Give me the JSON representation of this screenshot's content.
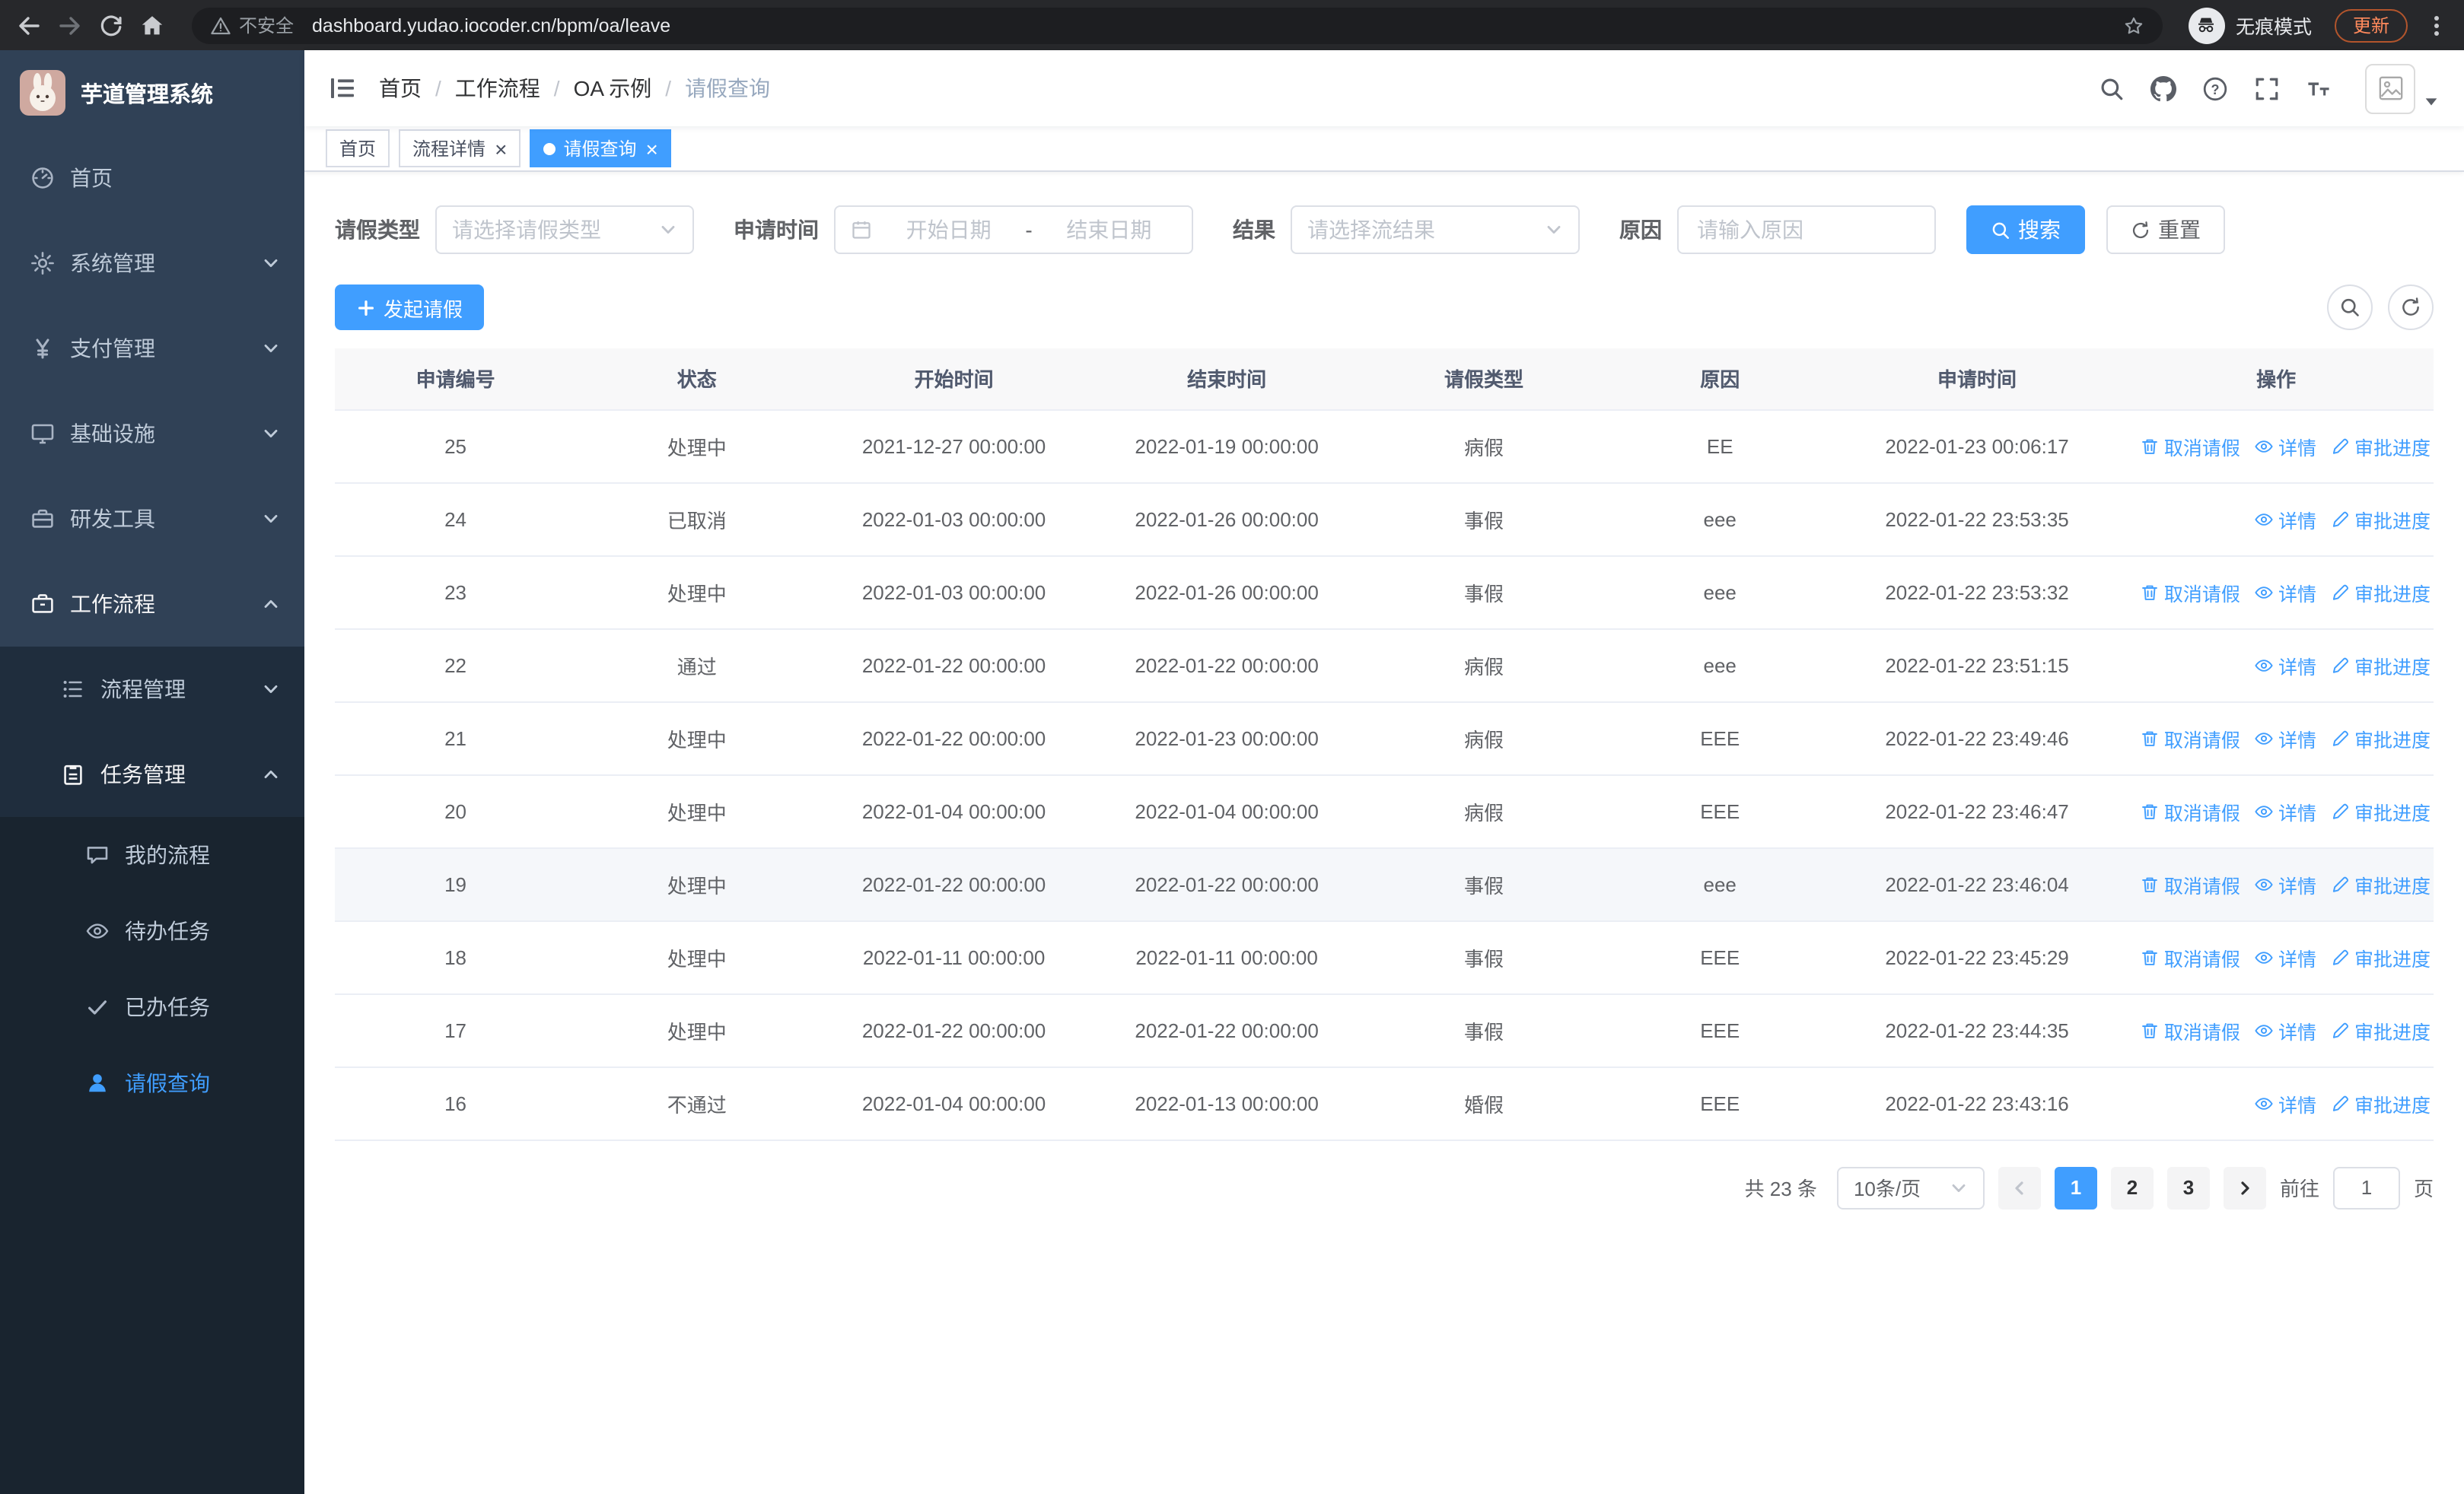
{
  "colors": {
    "primary": "#409eff",
    "sidebar_bg": "#304156",
    "submenu_bg": "#1f2d3d",
    "active_tab_bg": "#409eff"
  },
  "browser": {
    "security_label": "不安全",
    "url": "dashboard.yudao.iocoder.cn/bpm/oa/leave",
    "incognito_label": "无痕模式",
    "update_label": "更新"
  },
  "sidebar": {
    "logo_title": "芋道管理系统",
    "menu": [
      {
        "label": "首页",
        "icon": "dashboard-icon",
        "level": 1
      },
      {
        "label": "系统管理",
        "icon": "gear-icon",
        "level": 1,
        "arrow": "down"
      },
      {
        "label": "支付管理",
        "icon": "yen-icon",
        "level": 1,
        "arrow": "down"
      },
      {
        "label": "基础设施",
        "icon": "monitor-icon",
        "level": 1,
        "arrow": "down"
      },
      {
        "label": "研发工具",
        "icon": "toolbox-icon",
        "level": 1,
        "arrow": "down"
      },
      {
        "label": "工作流程",
        "icon": "briefcase-icon",
        "level": 1,
        "arrow": "up",
        "open": true
      },
      {
        "label": "流程管理",
        "icon": "process-icon",
        "level": 2,
        "arrow": "down"
      },
      {
        "label": "任务管理",
        "icon": "task-icon",
        "level": 2,
        "arrow": "up",
        "open": true
      },
      {
        "label": "我的流程",
        "icon": "chat-icon",
        "level": 3
      },
      {
        "label": "待办任务",
        "icon": "eye-icon",
        "level": 3
      },
      {
        "label": "已办任务",
        "icon": "check-icon",
        "level": 3
      },
      {
        "label": "请假查询",
        "icon": "user-icon",
        "level": 3,
        "active": true
      }
    ]
  },
  "header": {
    "breadcrumb": [
      "首页",
      "工作流程",
      "OA 示例",
      "请假查询"
    ],
    "tools": [
      "search-icon",
      "github-icon",
      "help-icon",
      "fullscreen-icon",
      "font-size-icon"
    ]
  },
  "tabs": [
    {
      "label": "首页",
      "closable": false,
      "active": false
    },
    {
      "label": "流程详情",
      "closable": true,
      "active": false
    },
    {
      "label": "请假查询",
      "closable": true,
      "active": true
    }
  ],
  "filters": {
    "leave_type_label": "请假类型",
    "leave_type_placeholder": "请选择请假类型",
    "apply_time_label": "申请时间",
    "start_date_placeholder": "开始日期",
    "range_separator": "-",
    "end_date_placeholder": "结束日期",
    "result_label": "结果",
    "result_placeholder": "请选择流结果",
    "reason_label": "原因",
    "reason_placeholder": "请输入原因",
    "search_button": "搜索",
    "reset_button": "重置"
  },
  "toolbar": {
    "create_button": "发起请假"
  },
  "table": {
    "columns": [
      "申请编号",
      "状态",
      "开始时间",
      "结束时间",
      "请假类型",
      "原因",
      "申请时间",
      "操作"
    ],
    "actions_def": {
      "cancel": {
        "label": "取消请假",
        "icon": "trash-icon"
      },
      "detail": {
        "label": "详情",
        "icon": "eye-icon"
      },
      "progress": {
        "label": "审批进度",
        "icon": "edit-icon"
      }
    },
    "rows": [
      {
        "id": "25",
        "status": "处理中",
        "start": "2021-12-27 00:00:00",
        "end": "2022-01-19 00:00:00",
        "type": "病假",
        "reason": "EE",
        "applied": "2022-01-23 00:06:17",
        "actions": [
          "cancel",
          "detail",
          "progress"
        ]
      },
      {
        "id": "24",
        "status": "已取消",
        "start": "2022-01-03 00:00:00",
        "end": "2022-01-26 00:00:00",
        "type": "事假",
        "reason": "eee",
        "applied": "2022-01-22 23:53:35",
        "actions": [
          "detail",
          "progress"
        ]
      },
      {
        "id": "23",
        "status": "处理中",
        "start": "2022-01-03 00:00:00",
        "end": "2022-01-26 00:00:00",
        "type": "事假",
        "reason": "eee",
        "applied": "2022-01-22 23:53:32",
        "actions": [
          "cancel",
          "detail",
          "progress"
        ]
      },
      {
        "id": "22",
        "status": "通过",
        "start": "2022-01-22 00:00:00",
        "end": "2022-01-22 00:00:00",
        "type": "病假",
        "reason": "eee",
        "applied": "2022-01-22 23:51:15",
        "actions": [
          "detail",
          "progress"
        ]
      },
      {
        "id": "21",
        "status": "处理中",
        "start": "2022-01-22 00:00:00",
        "end": "2022-01-23 00:00:00",
        "type": "病假",
        "reason": "EEE",
        "applied": "2022-01-22 23:49:46",
        "actions": [
          "cancel",
          "detail",
          "progress"
        ]
      },
      {
        "id": "20",
        "status": "处理中",
        "start": "2022-01-04 00:00:00",
        "end": "2022-01-04 00:00:00",
        "type": "病假",
        "reason": "EEE",
        "applied": "2022-01-22 23:46:47",
        "actions": [
          "cancel",
          "detail",
          "progress"
        ]
      },
      {
        "id": "19",
        "status": "处理中",
        "start": "2022-01-22 00:00:00",
        "end": "2022-01-22 00:00:00",
        "type": "事假",
        "reason": "eee",
        "applied": "2022-01-22 23:46:04",
        "actions": [
          "cancel",
          "detail",
          "progress"
        ],
        "highlighted": true
      },
      {
        "id": "18",
        "status": "处理中",
        "start": "2022-01-11 00:00:00",
        "end": "2022-01-11 00:00:00",
        "type": "事假",
        "reason": "EEE",
        "applied": "2022-01-22 23:45:29",
        "actions": [
          "cancel",
          "detail",
          "progress"
        ]
      },
      {
        "id": "17",
        "status": "处理中",
        "start": "2022-01-22 00:00:00",
        "end": "2022-01-22 00:00:00",
        "type": "事假",
        "reason": "EEE",
        "applied": "2022-01-22 23:44:35",
        "actions": [
          "cancel",
          "detail",
          "progress"
        ]
      },
      {
        "id": "16",
        "status": "不通过",
        "start": "2022-01-04 00:00:00",
        "end": "2022-01-13 00:00:00",
        "type": "婚假",
        "reason": "EEE",
        "applied": "2022-01-22 23:43:16",
        "actions": [
          "detail",
          "progress"
        ]
      }
    ]
  },
  "pagination": {
    "total_label": "共 23 条",
    "page_size": "10条/页",
    "pages": [
      "1",
      "2",
      "3"
    ],
    "active_page": "1",
    "goto_label": "前往",
    "goto_value": "1",
    "page_unit": "页"
  }
}
